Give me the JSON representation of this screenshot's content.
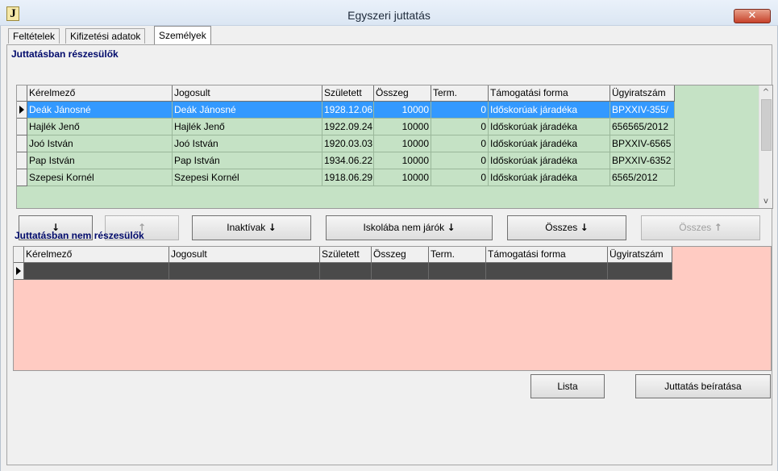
{
  "window": {
    "app_icon": "J",
    "title": "Egyszeri juttatás",
    "close_glyph": "✕"
  },
  "tabs": [
    {
      "label": "Feltételek",
      "active": false
    },
    {
      "label": "Kifizetési adatok",
      "active": false
    },
    {
      "label": "Személyek",
      "active": true
    }
  ],
  "receiving": {
    "label": "Juttatásban részesülők",
    "columns": [
      "Kérelmező",
      "Jogosult",
      "Született",
      "Összeg",
      "Term.",
      "Támogatási forma",
      "Ügyiratszám"
    ],
    "rows": [
      [
        "Deák Jánosné",
        "Deák Jánosné",
        "1928.12.06",
        "10000",
        "0",
        "Időskorúak járadéka",
        "BPXXIV-355/"
      ],
      [
        "Hajlék Jenő",
        "Hajlék Jenő",
        "1922.09.24",
        "10000",
        "0",
        "Időskorúak járadéka",
        "656565/2012"
      ],
      [
        "Joó István",
        "Joó István",
        "1920.03.03",
        "10000",
        "0",
        "Időskorúak járadéka",
        "BPXXIV-6565"
      ],
      [
        "Pap István",
        "Pap István",
        "1934.06.22",
        "10000",
        "0",
        "Időskorúak járadéka",
        "BPXXIV-6352"
      ],
      [
        "Szepesi Kornél",
        "Szepesi Kornél",
        "1918.06.29",
        "10000",
        "0",
        "Időskorúak járadéka",
        "6565/2012"
      ]
    ],
    "selected_row": 0
  },
  "buttons": {
    "down": "↓",
    "up": "↑",
    "inactive_label": "Inaktívak",
    "not_school_label": "Iskolába nem járók",
    "all_down_label": "Összes",
    "all_up_label": "Összes",
    "lista": "Lista",
    "save": "Juttatás beíratása"
  },
  "icons": {
    "down_arrow": "↓",
    "up_arrow": "↑",
    "scroll_up": "^",
    "scroll_down": "v"
  },
  "not_receiving": {
    "label": "Juttatásban nem részesülők",
    "columns": [
      "Kérelmező",
      "Jogosult",
      "Született",
      "Összeg",
      "Term.",
      "Támogatási forma",
      "Ügyiratszám"
    ]
  }
}
